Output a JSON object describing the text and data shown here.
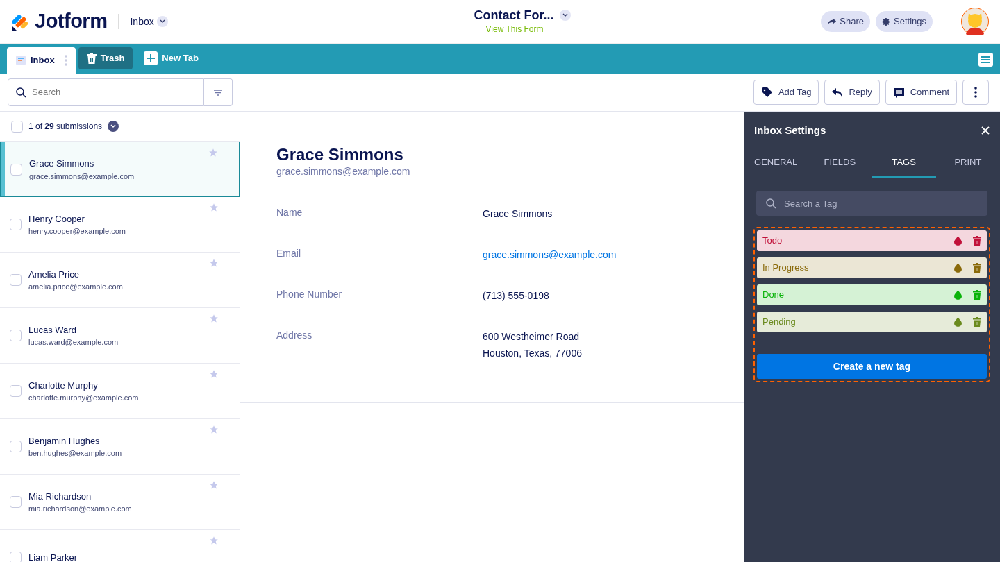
{
  "header": {
    "brand": "Jotform",
    "section": "Inbox",
    "form_title": "Contact For...",
    "form_link": "View This Form",
    "buttons": [
      "Share",
      "Settings"
    ]
  },
  "tabs": [
    {
      "label": "Inbox",
      "selected": true
    },
    {
      "label": "Trash",
      "selected": false
    }
  ],
  "new_tab": "New Tab",
  "search": {
    "placeholder": "Search"
  },
  "actions": [
    "Add Tag",
    "Reply",
    "Comment"
  ],
  "select_all": {
    "checked": false
  },
  "list_summary": "1 of **29** submissions",
  "submissions": [
    {
      "name": "Grace Simmons",
      "email": "grace.simmons@example.com",
      "selected": true
    },
    {
      "name": "Henry Cooper",
      "email": "henry.cooper@example.com",
      "selected": false
    },
    {
      "name": "Amelia Price",
      "email": "amelia.price@example.com",
      "selected": false
    },
    {
      "name": "Lucas Ward",
      "email": "lucas.ward@example.com",
      "selected": false
    },
    {
      "name": "Charlotte Murphy",
      "email": "charlotte.murphy@example.com",
      "selected": false
    },
    {
      "name": "Benjamin Hughes",
      "email": "ben.hughes@example.com",
      "selected": false
    },
    {
      "name": "Mia Richardson",
      "email": "mia.richardson@example.com",
      "selected": false
    },
    {
      "name": "Liam Parker",
      "selected": false
    }
  ],
  "detail": {
    "name": "Grace Simmons",
    "email": "grace.simmons@example.com",
    "fields": [
      {
        "label": "Name",
        "value": [
          "Grace Simmons"
        ],
        "kind": "text"
      },
      {
        "label": "Email",
        "value": [
          "grace.simmons@example.com"
        ],
        "kind": "link"
      },
      {
        "label": "Phone Number",
        "value": [
          "(713) 555-0198"
        ],
        "kind": "text"
      },
      {
        "label": "Address",
        "value": [
          "600 Westheimer Road",
          "Houston, Texas, 77006"
        ],
        "kind": "text"
      }
    ]
  },
  "settings": {
    "title": "Inbox Settings",
    "tabs": [
      {
        "label": "GENERAL",
        "selected": false
      },
      {
        "label": "FIELDS",
        "selected": false
      },
      {
        "label": "TAGS",
        "selected": true
      },
      {
        "label": "PRINT",
        "selected": false
      }
    ],
    "search": {
      "placeholder": "Search a Tag"
    },
    "tags": [
      {
        "label": "Todo",
        "color": "#c1113a"
      },
      {
        "label": "In Progress",
        "color": "#8a6a0a"
      },
      {
        "label": "Done",
        "color": "#0ab30a"
      },
      {
        "label": "Pending",
        "color": "#6a8a1e"
      }
    ],
    "create_button": "Create a new tag"
  }
}
